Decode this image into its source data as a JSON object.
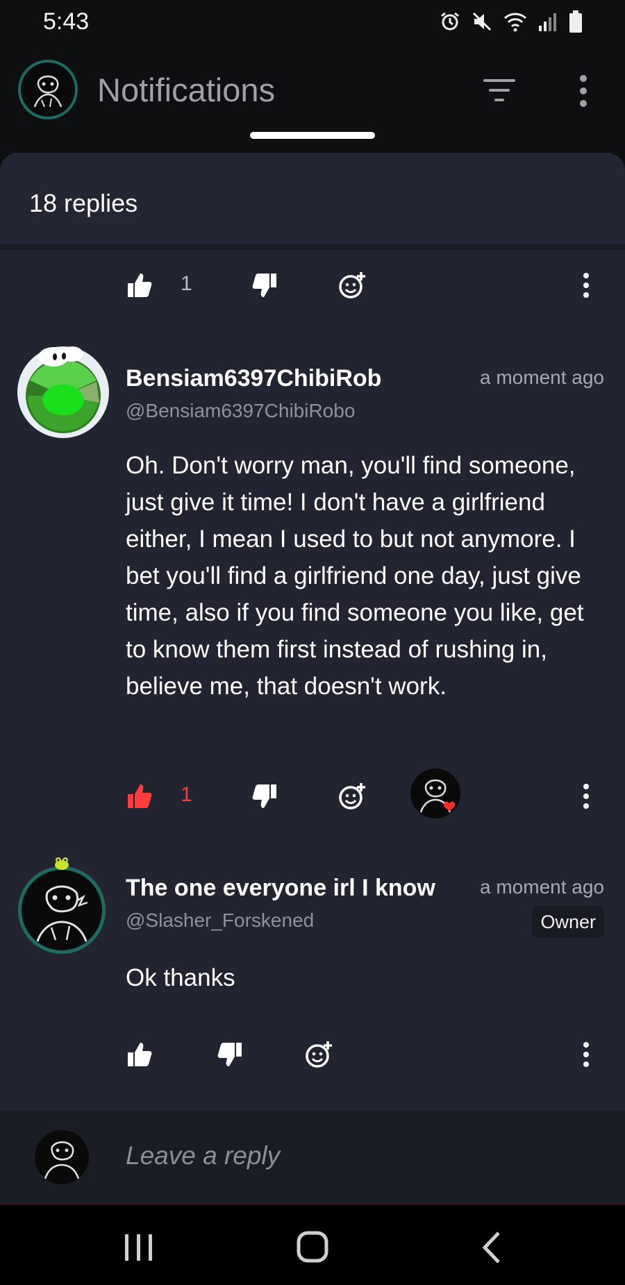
{
  "status_bar": {
    "time": "5:43",
    "icons": [
      "alarm-icon",
      "mute-icon",
      "wifi-icon",
      "signal-icon",
      "battery-icon"
    ]
  },
  "header": {
    "title": "Notifications",
    "icons": [
      "filter-icon",
      "more-vert-icon"
    ]
  },
  "sheet": {
    "replies_label": "18 replies"
  },
  "top_actions": {
    "like_count": "1"
  },
  "comments": [
    {
      "username": "Bensiam6397ChibiRobo",
      "handle": "@Bensiam6397ChibiRobo",
      "timestamp": "a moment ago",
      "text": "Oh. Don't worry man, you'll find someone, just give it time! I don't have a girlfriend either, I mean I used to but not anymore. I bet you'll find a girlfriend one day, just give time, also if you find someone you like, get to know them first instead of rushing in, believe me, that doesn't work.",
      "like_count": "1",
      "liked": true,
      "hearted_by_creator": true
    },
    {
      "username": "The one everyone irl I know",
      "handle": "@Slasher_Forskened",
      "timestamp": "a moment ago",
      "badge": "Owner",
      "text": "Ok thanks"
    }
  ],
  "reply_bar": {
    "placeholder": "Leave a reply"
  },
  "nav_bar": {
    "icons": [
      "recent-apps-icon",
      "home-icon",
      "back-icon"
    ]
  },
  "colors": {
    "sheet_bg": "#222531",
    "like_active": "#ff3d3d",
    "owner_ring": "#1d6b61"
  }
}
